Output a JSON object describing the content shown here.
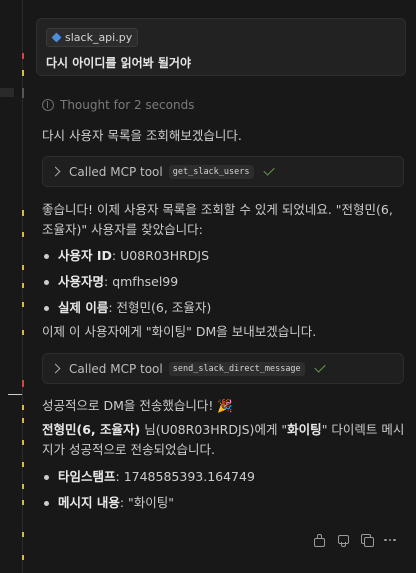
{
  "user_message": {
    "file_chip": "slack_api.py",
    "file_icon": "python-file-icon",
    "text": "다시 아이디를 읽어봐 될거야"
  },
  "thought": {
    "label": "Thought for 2 seconds",
    "icon": "brain-icon"
  },
  "assistant": {
    "para1": "다시 사용자 목록을 조회해보겠습니다.",
    "tool_call_1": {
      "label": "Called MCP tool",
      "tool": "get_slack_users"
    },
    "para2_line1": "좋습니다! 이제 사용자 목록을 조회할 수 있게 되었네요. \"전형민(6,",
    "para2_line2": "조율자)\" 사용자를 찾았습니다:",
    "user_info": [
      {
        "key": "사용자 ID",
        "value": ": U08R03HRDJS"
      },
      {
        "key": "사용자명",
        "value": ": qmfhsel99"
      },
      {
        "key": "실제 이름",
        "value": ": 전형민(6, 조율자)"
      }
    ],
    "para3": "이제 이 사용자에게 \"화이팅\" DM을 보내보겠습니다.",
    "tool_call_2": {
      "label": "Called MCP tool",
      "tool": "send_slack_direct_message"
    },
    "para4": "성공적으로 DM을 전송했습니다! 🎉",
    "para5_bold1": "전형민(6, 조율자)",
    "para5_mid": " 님(U08R03HRDJS)에게 \"",
    "para5_bold2": "화이팅",
    "para5_end": "\" 다이렉트 메시",
    "para5_line2": "지가 성공적으로 전송되었습니다.",
    "result_info": [
      {
        "key": "타임스탬프",
        "value": ": 1748585393.164749"
      },
      {
        "key": "메시지 내용",
        "value": ": \"화이팅\""
      }
    ]
  },
  "colors": {
    "background": "#181818",
    "accent_yellow": "#d7b94a",
    "accent_red": "#c74e39",
    "success_check": "#6a9955"
  }
}
